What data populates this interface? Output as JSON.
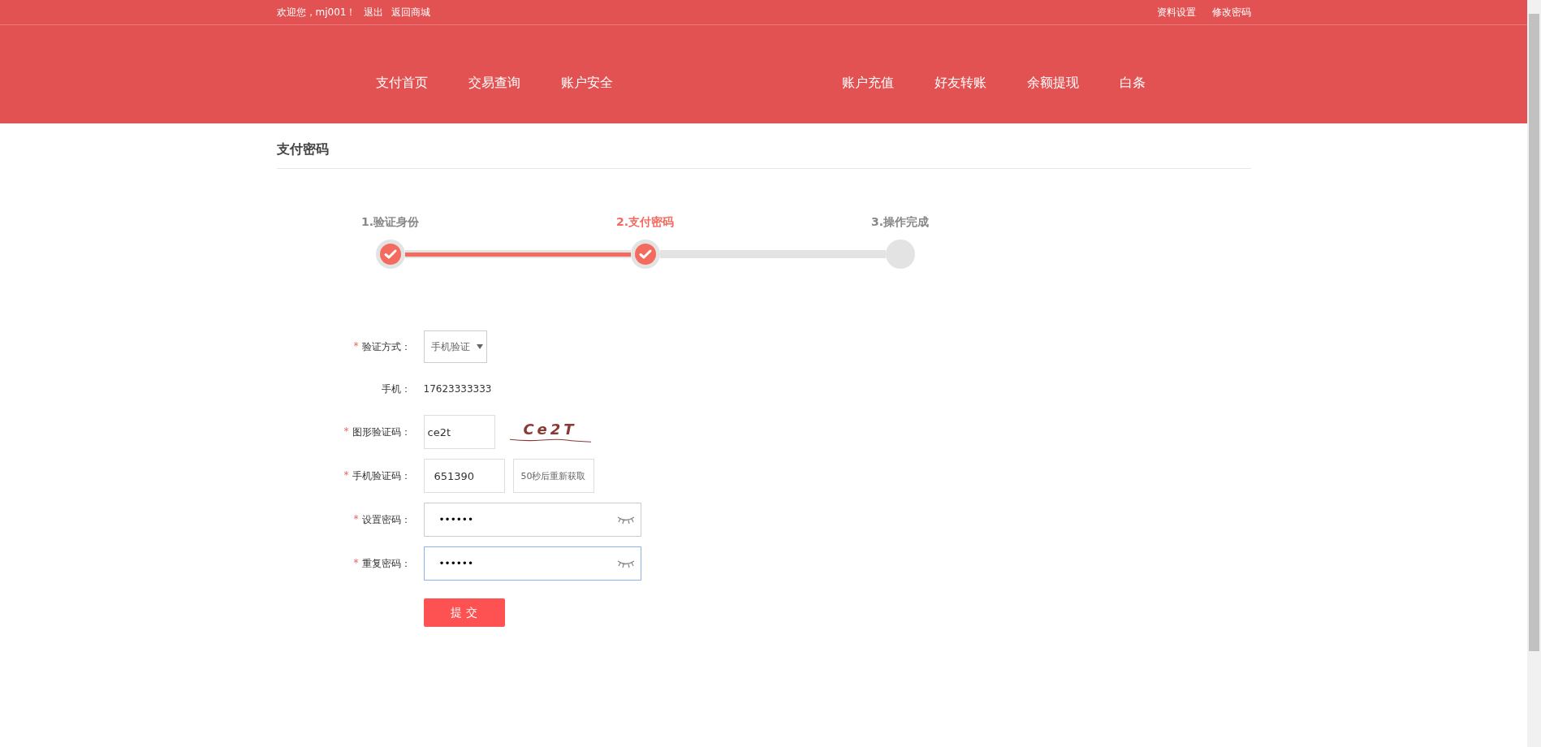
{
  "top_bar": {
    "greeting": "欢迎您，mj001！",
    "left_links": [
      "退出",
      "返回商城"
    ],
    "right_links": [
      "资料设置",
      "修改密码"
    ]
  },
  "nav": {
    "left": [
      "支付首页",
      "交易查询",
      "账户安全"
    ],
    "right": [
      "账户充值",
      "好友转账",
      "余额提现",
      "白条"
    ]
  },
  "page_title": "支付密码",
  "steps": [
    {
      "label": "1.验证身份",
      "completed": true,
      "selected": false
    },
    {
      "label": "2.支付密码",
      "completed": true,
      "selected": true
    },
    {
      "label": "3.操作完成",
      "completed": false,
      "selected": false
    }
  ],
  "form": [
    {
      "kind": "select",
      "required_mark": "*",
      "label": "验证方式：",
      "value": "手机验证"
    },
    {
      "kind": "static",
      "label": "手机：",
      "value": "17623333333"
    },
    {
      "kind": "captcha",
      "required_mark": "*",
      "label": "图形验证码：",
      "value": "ce2t",
      "captcha_text": "Ce2T"
    },
    {
      "kind": "sms",
      "required_mark": "*",
      "label": "手机验证码：",
      "value": "651390",
      "button": "50秒后重新获取"
    },
    {
      "kind": "password",
      "required_mark": "*",
      "label": "设置密码：",
      "value": "••••••",
      "focused": false
    },
    {
      "kind": "password",
      "required_mark": "*",
      "label": "重复密码：",
      "value": "••••••",
      "focused": true
    }
  ],
  "submit": "提 交"
}
